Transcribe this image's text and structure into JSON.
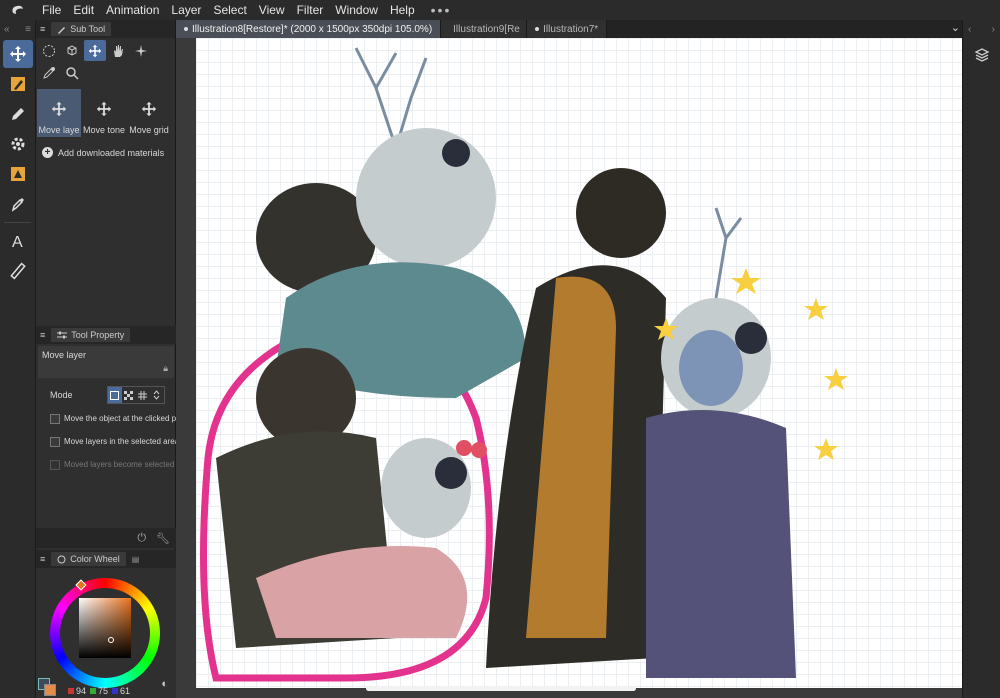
{
  "menubar": {
    "items": [
      "File",
      "Edit",
      "Animation",
      "Layer",
      "Select",
      "View",
      "Filter",
      "Window",
      "Help"
    ],
    "more": "•••"
  },
  "tabs": [
    {
      "label": "Illustration8[Restore]* (2000 x 1500px 350dpi 105.0%)",
      "active": true
    },
    {
      "label": "Illustration9[Re",
      "active": false
    },
    {
      "label": "Illustration7*",
      "active": false
    }
  ],
  "toolbar": {
    "tools": [
      "move-icon",
      "pen-nib-icon",
      "pencil-icon",
      "gear-icon",
      "fill-hand-icon",
      "dropper-pen-icon",
      "text-icon",
      "ruler-icon"
    ]
  },
  "subtool": {
    "panel_title": "Sub Tool",
    "icons": [
      "lasso-icon",
      "3d-rotate-icon",
      "move-icon",
      "hand-icon",
      "magic-wand-icon",
      "eyedropper-icon",
      "magnifier-icon"
    ],
    "tiles": [
      "Move laye",
      "Move tone",
      "Move grid"
    ],
    "add_materials": "Add downloaded materials"
  },
  "tool_property": {
    "panel_title": "Tool Property",
    "tool_name": "Move layer",
    "mode_label": "Mode",
    "options": [
      {
        "label": "Move the object at the clicked pos",
        "enabled": true
      },
      {
        "label": "Move layers in the selected area",
        "enabled": true
      },
      {
        "label": "Moved layers become selected",
        "enabled": false
      }
    ]
  },
  "color": {
    "panel_title": "Color Wheel",
    "main_color": "#e8731e",
    "sub_color": "#3d4a5c",
    "r": "94",
    "g": "75",
    "b": "61"
  }
}
